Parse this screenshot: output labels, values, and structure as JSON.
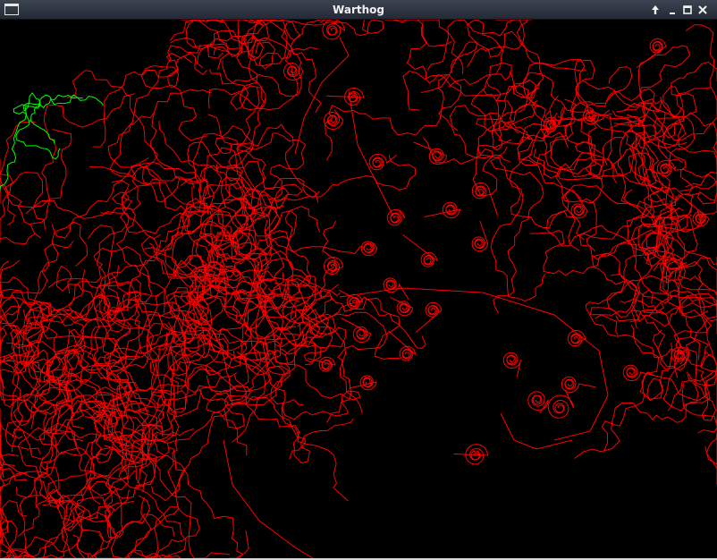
{
  "window": {
    "title": "Warthog",
    "controls": [
      "shade-icon",
      "minimize-icon",
      "maximize-icon",
      "close-icon"
    ]
  },
  "canvas": {
    "background": "#000000",
    "trail_colors": {
      "red_swarm": "#ff0000",
      "green_agent": "#00ff00"
    }
  }
}
